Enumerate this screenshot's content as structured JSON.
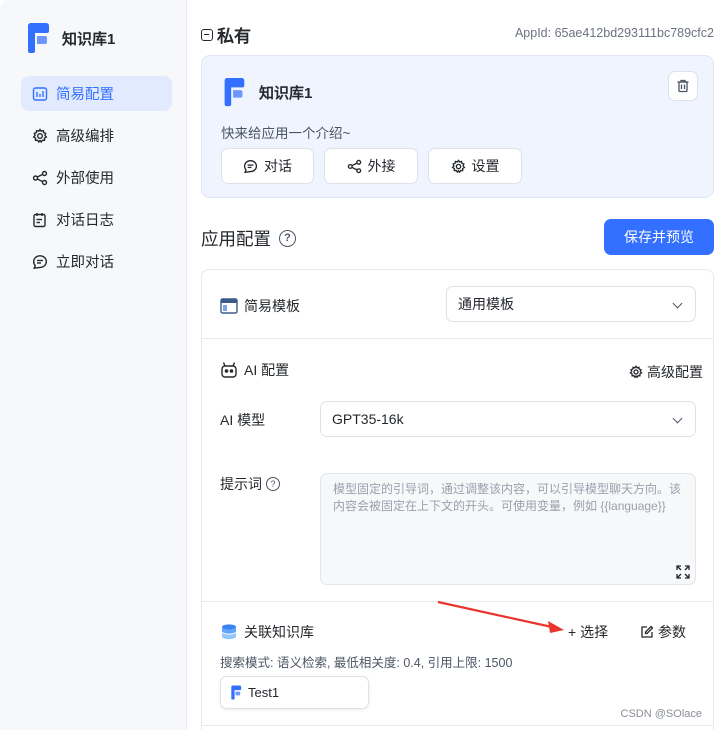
{
  "app": {
    "name": "知识库1"
  },
  "sidebar": {
    "items": [
      {
        "label": "简易配置",
        "icon": "sliders-icon",
        "active": true
      },
      {
        "label": "高级编排",
        "icon": "gear-icon",
        "active": false
      },
      {
        "label": "外部使用",
        "icon": "share-icon",
        "active": false
      },
      {
        "label": "对话日志",
        "icon": "log-icon",
        "active": false
      },
      {
        "label": "立即对话",
        "icon": "chat-icon",
        "active": false
      }
    ]
  },
  "header": {
    "visibility": "私有",
    "appid": "AppId: 65ae412bd293111bc789cfc2"
  },
  "appcard": {
    "title": "知识库1",
    "intro": "快来给应用一个介绍~",
    "buttons": {
      "chat": "对话",
      "share": "外接",
      "settings": "设置"
    }
  },
  "config": {
    "section_title": "应用配置",
    "save_label": "保存并预览",
    "template_label": "简易模板",
    "template_value": "通用模板",
    "ai_config_label": "AI 配置",
    "advanced_label": "高级配置",
    "model_label": "AI 模型",
    "model_value": "GPT35-16k",
    "prompt_label": "提示词",
    "prompt_placeholder": "模型固定的引导词，通过调整该内容，可以引导模型聊天方向。该内容会被固定在上下文的开头。可使用变量，例如 {{language}}",
    "dataset_label": "关联知识库",
    "select_label": "+ 选择",
    "params_label": "参数",
    "dataset_meta": "搜索模式: 语义检索, 最低相关度: 0.4, 引用上限: 1500",
    "dataset_chip": "Test1"
  },
  "watermark": "CSDN @SOlace",
  "colors": {
    "accent": "#3370ff",
    "arrow": "#e8362e"
  }
}
